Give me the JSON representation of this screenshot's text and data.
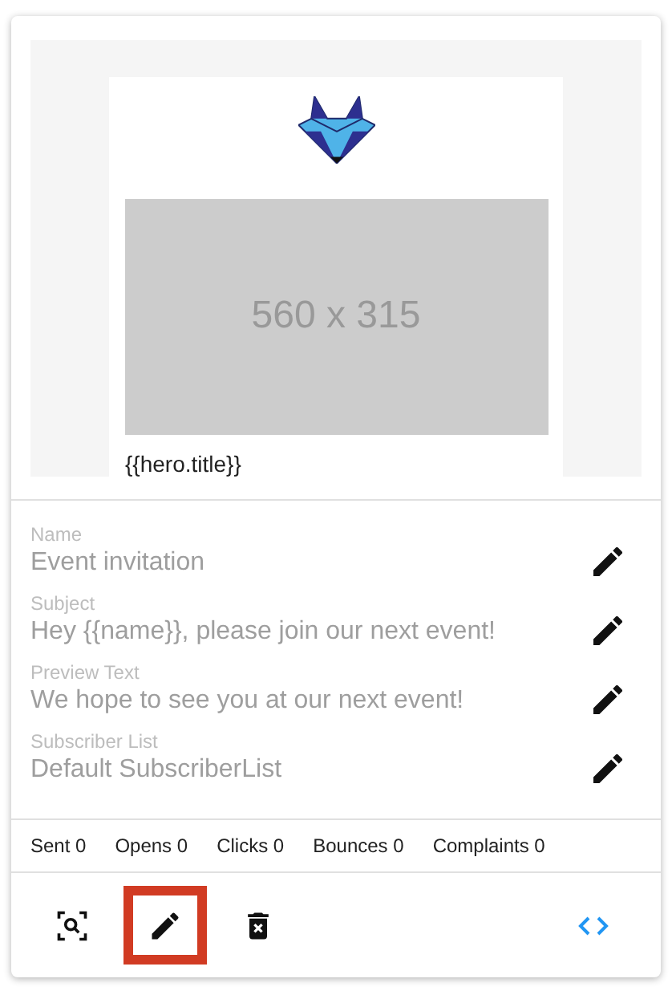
{
  "preview": {
    "placeholder_label": "560 x 315",
    "hero_title": "{{hero.title}}"
  },
  "fields": [
    {
      "label": "Name",
      "value": "Event invitation"
    },
    {
      "label": "Subject",
      "value": "Hey {{name}}, please join our next event!"
    },
    {
      "label": "Preview Text",
      "value": "We hope to see you at our next event!"
    },
    {
      "label": "Subscriber List",
      "value": "Default SubscriberList"
    }
  ],
  "stats": [
    "Sent 0",
    "Opens 0",
    "Clicks 0",
    "Bounces 0",
    "Complaints 0"
  ],
  "actions": [
    {
      "kind": "preview",
      "highlighted": false
    },
    {
      "kind": "edit",
      "highlighted": true
    },
    {
      "kind": "delete",
      "highlighted": false
    },
    {
      "kind": "code",
      "highlighted": false
    }
  ]
}
